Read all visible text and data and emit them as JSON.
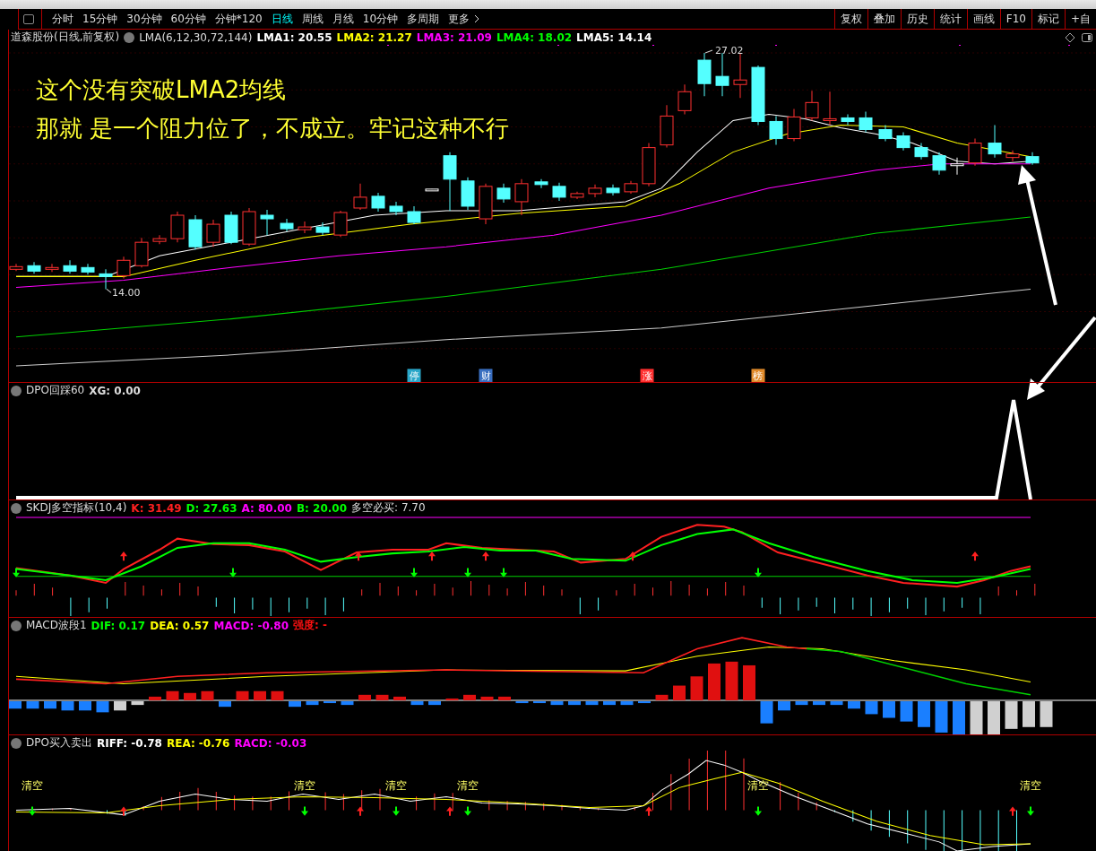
{
  "toolbar": {
    "periods": [
      {
        "label": "分时",
        "selected": false
      },
      {
        "label": "15分钟",
        "selected": false
      },
      {
        "label": "30分钟",
        "selected": false
      },
      {
        "label": "60分钟",
        "selected": false
      },
      {
        "label": "分钟*120",
        "selected": false
      },
      {
        "label": "日线",
        "selected": true
      },
      {
        "label": "周线",
        "selected": false
      },
      {
        "label": "月线",
        "selected": false
      },
      {
        "label": "10分钟",
        "selected": false
      },
      {
        "label": "多周期",
        "selected": false
      },
      {
        "label": "更多",
        "selected": false
      }
    ],
    "tools": [
      "复权",
      "叠加",
      "历史",
      "统计",
      "画线",
      "F10",
      "标记",
      "+自"
    ]
  },
  "main_chart": {
    "title": "道森股份(日线,前复权)",
    "indicator": "LMA(6,12,30,72,144)",
    "values": [
      {
        "text": "LMA1: 20.55",
        "color": "#ffffff"
      },
      {
        "text": "LMA2: 21.27",
        "color": "#ffff00"
      },
      {
        "text": "LMA3: 21.09",
        "color": "#ff00ff"
      },
      {
        "text": "LMA4: 18.02",
        "color": "#00ff00"
      },
      {
        "text": "LMA5: 14.14",
        "color": "#ffffff"
      }
    ],
    "high_label": "27.02",
    "low_label": "14.00",
    "annotations": [
      "这个没有突破LMA2均线",
      "那就 是一个阻力位了，不成立。牢记这种不行"
    ],
    "event_markers": [
      {
        "text": "停",
        "color": "#2aa7c9"
      },
      {
        "text": "财",
        "color": "#3a6fc0"
      },
      {
        "text": "涨",
        "color": "#ff3030"
      },
      {
        "text": "榜",
        "color": "#e08a2a"
      }
    ]
  },
  "panels": [
    {
      "kind": "dpo",
      "name": "DPO回踩60",
      "values": [
        {
          "text": "XG: 0.00",
          "color": "#dddddd"
        }
      ]
    },
    {
      "kind": "skdj",
      "name": "SKDJ多空指标(10,4)",
      "values": [
        {
          "text": "K: 31.49",
          "color": "#ff2020"
        },
        {
          "text": "D: 27.63",
          "color": "#00ff00"
        },
        {
          "text": "A: 80.00",
          "color": "#ff00ff"
        },
        {
          "text": "B: 20.00",
          "color": "#00ff00"
        },
        {
          "text": "多空必买: 7.70"
        }
      ]
    },
    {
      "kind": "macd",
      "name": "MACD波段1",
      "values": [
        {
          "text": "DIF: 0.17",
          "color": "#00ff00"
        },
        {
          "text": "DEA: 0.57",
          "color": "#ffff00"
        },
        {
          "text": "MACD: -0.80",
          "color": "#ff00ff"
        },
        {
          "text": "强度: -",
          "color": "#ff1010"
        }
      ]
    },
    {
      "kind": "dpo_trade",
      "name": "DPO买入卖出",
      "values": [
        {
          "text": "RIFF: -0.78",
          "color": "#ffffff"
        },
        {
          "text": "REA: -0.76",
          "color": "#ffff00"
        },
        {
          "text": "RACD: -0.03",
          "color": "#ff00ff"
        }
      ],
      "signal_labels": [
        "清空",
        "清空",
        "清空",
        "清空",
        "清空",
        "清空"
      ]
    }
  ]
}
